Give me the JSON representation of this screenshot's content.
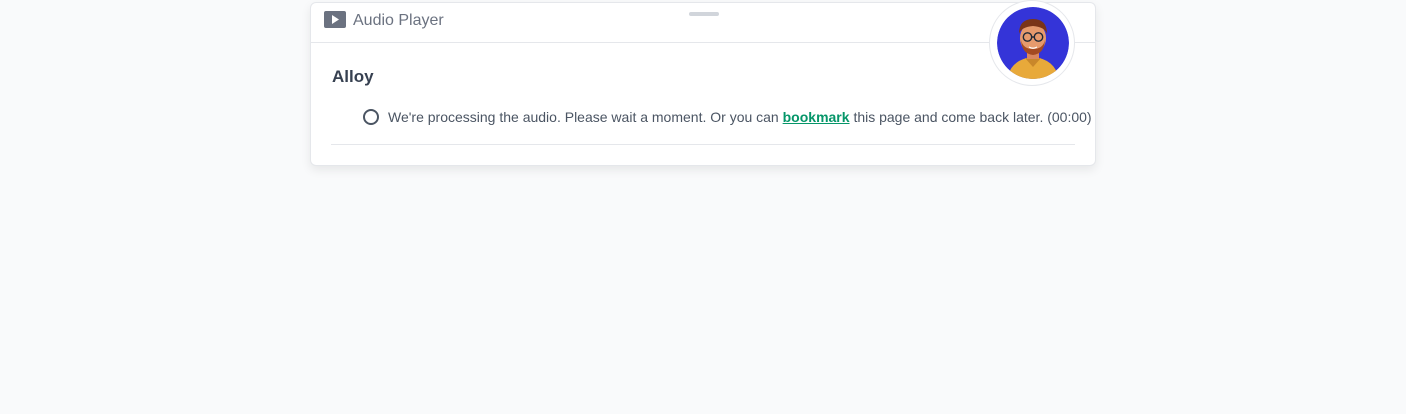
{
  "player": {
    "icon": "play-icon",
    "title": "Audio Player"
  },
  "voice": {
    "name": "Alloy"
  },
  "status": {
    "before_link": "We're processing the audio. Please wait a moment. Or you can",
    "link_label": "bookmark",
    "after_link": "this page and come back later.",
    "elapsed": "(00:00)"
  },
  "avatar": {
    "icon": "avatar-illustration"
  },
  "colors": {
    "accent_link": "#059669",
    "avatar_bg": "#3434d8",
    "page_bg": "#f9fafb"
  }
}
